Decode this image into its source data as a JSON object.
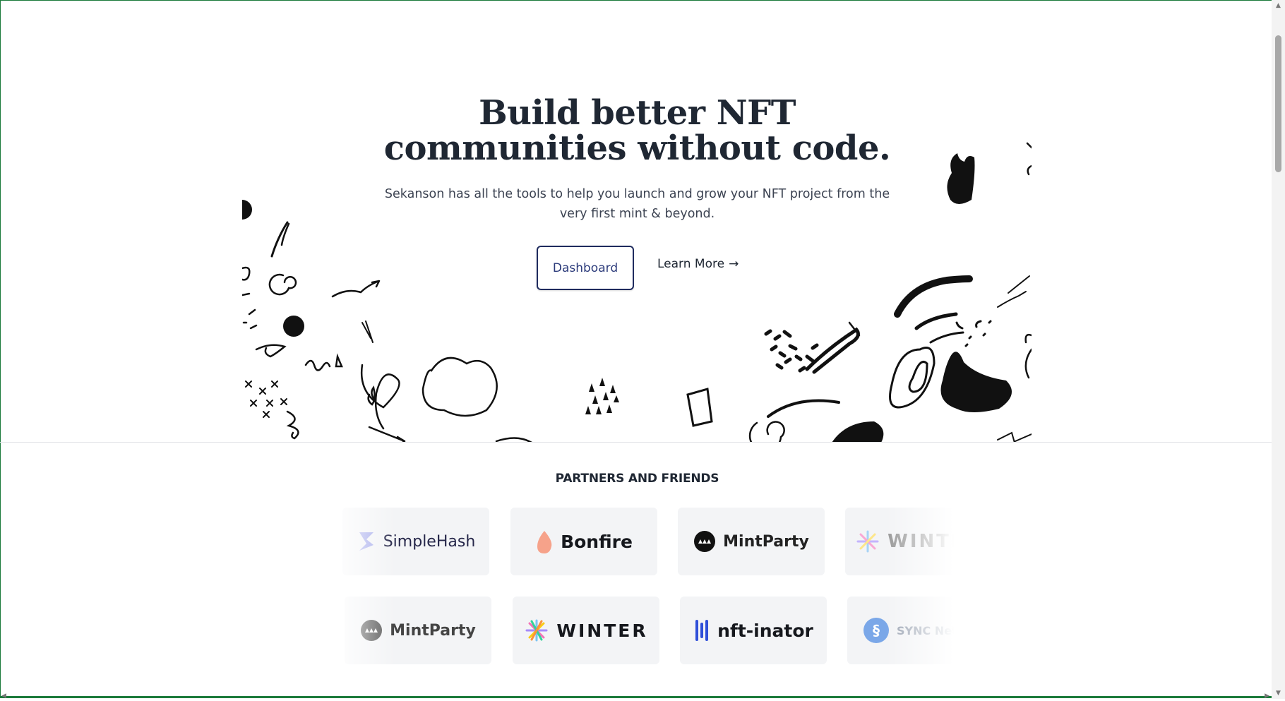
{
  "hero": {
    "title_line1": "Build better NFT",
    "title_line2": "communities without code.",
    "subtitle": "Sekanson has all the tools to help you launch and grow your NFT project from the very first mint & beyond.",
    "dashboard_label": "Dashboard",
    "learn_more_label": "Learn More",
    "learn_more_arrow": "→"
  },
  "partners": {
    "heading": "PARTNERS AND FRIENDS",
    "row1": [
      {
        "name": "SimpleHash",
        "icon": "simplehash-icon"
      },
      {
        "name": "Bonfire",
        "icon": "bonfire-icon"
      },
      {
        "name": "MintParty",
        "icon": "mintparty-icon"
      },
      {
        "name": "WINTER",
        "icon": "winter-icon"
      }
    ],
    "row2": [
      {
        "name": "MintParty",
        "icon": "mintparty-icon"
      },
      {
        "name": "WINTER",
        "icon": "winter-icon"
      },
      {
        "name": "nft-inator",
        "icon": "nftinator-icon"
      },
      {
        "name": "SYNC Network",
        "icon": "sync-icon"
      }
    ]
  },
  "colors": {
    "text_dark": "#1f2733",
    "button_border": "#1f2b5e",
    "card_bg": "#f3f4f6",
    "frame_border": "#1b7a3a"
  }
}
